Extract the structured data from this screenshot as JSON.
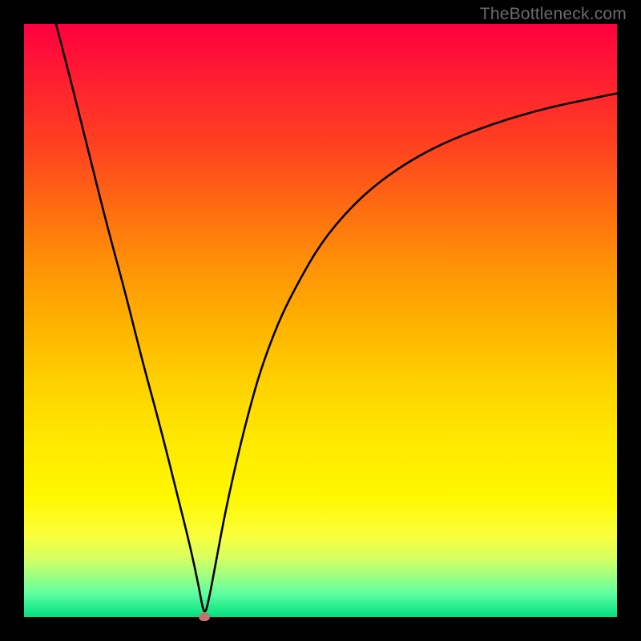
{
  "watermark": "TheBottleneck.com",
  "chart_data": {
    "type": "line",
    "title": "",
    "xlabel": "",
    "ylabel": "",
    "xlim": [
      0,
      100
    ],
    "ylim": [
      0,
      100
    ],
    "grid": false,
    "annotations": {
      "min_marker": {
        "x": 30.4,
        "y": 0,
        "color": "#c9716f"
      }
    },
    "background_gradient": {
      "top": "#ff0040",
      "mid_upper": "#ffb000",
      "mid_lower": "#fff800",
      "bottom": "#00e080"
    },
    "series": [
      {
        "name": "bottleneck-curve",
        "color": "#000000",
        "x": [
          5.4,
          8,
          11,
          14,
          17,
          20,
          23,
          26,
          28,
          29.5,
          30.4,
          31.2,
          32.5,
          34,
          36,
          38,
          40,
          43,
          46,
          50,
          55,
          60,
          66,
          72,
          80,
          88,
          96,
          100
        ],
        "y": [
          100,
          90,
          78,
          66,
          55,
          43,
          32,
          20,
          12,
          5,
          0,
          3,
          10,
          18,
          27,
          35,
          42,
          50,
          56,
          63,
          69,
          73.5,
          77.5,
          80.5,
          83.5,
          85.8,
          87.5,
          88.3
        ]
      }
    ]
  }
}
